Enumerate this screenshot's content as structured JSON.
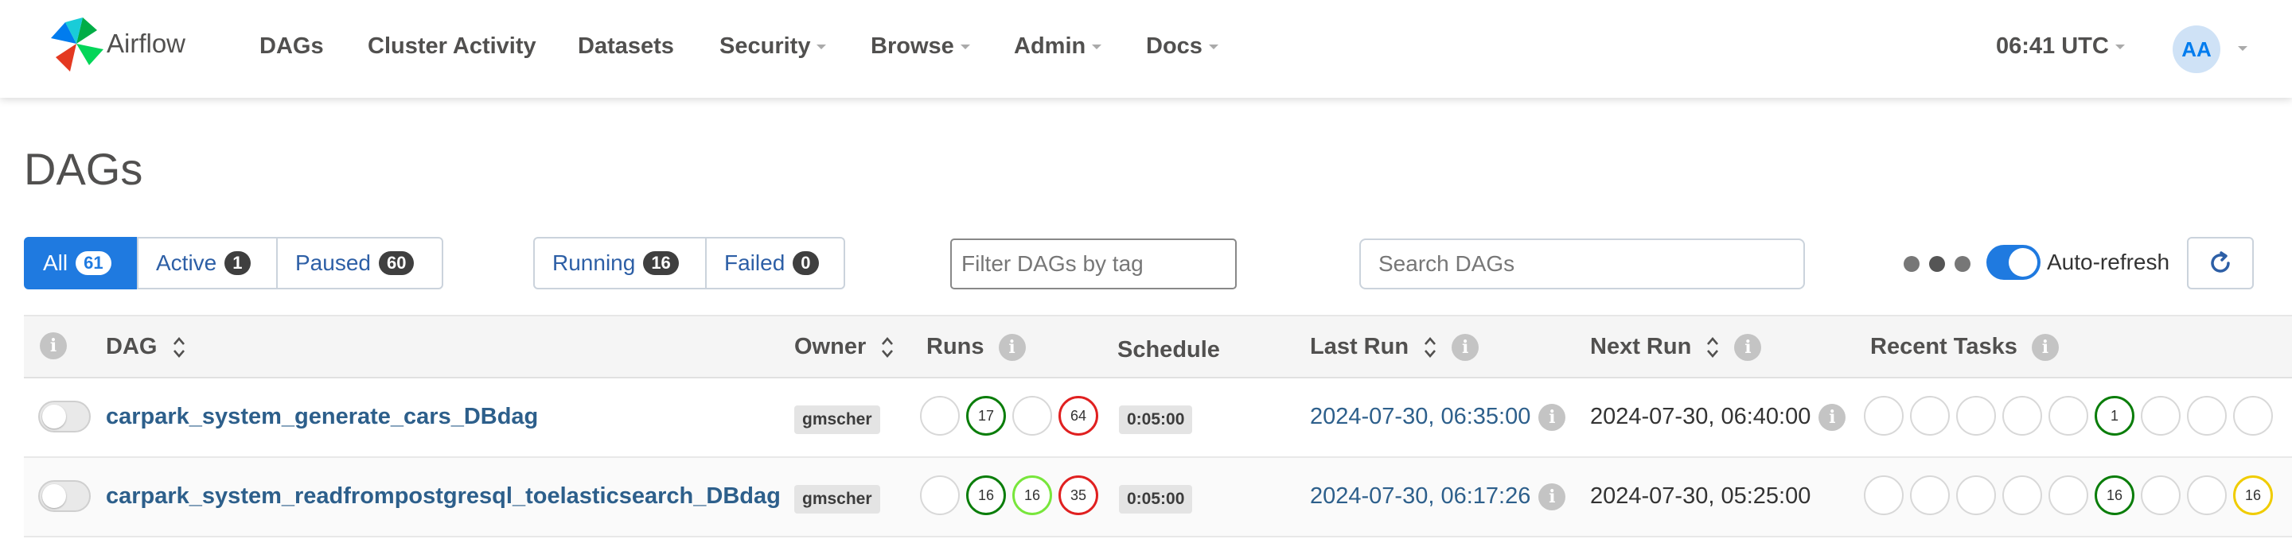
{
  "brand": {
    "name": "Airflow"
  },
  "nav": {
    "dags": "DAGs",
    "cluster_activity": "Cluster Activity",
    "datasets": "Datasets",
    "security": "Security",
    "browse": "Browse",
    "admin": "Admin",
    "docs": "Docs"
  },
  "clock": "06:41 UTC",
  "user": {
    "initials": "AA"
  },
  "page_title": "DAGs",
  "filters": {
    "all": {
      "label": "All",
      "count": "61"
    },
    "active": {
      "label": "Active",
      "count": "1"
    },
    "paused": {
      "label": "Paused",
      "count": "60"
    },
    "running": {
      "label": "Running",
      "count": "16"
    },
    "failed": {
      "label": "Failed",
      "count": "0"
    }
  },
  "tag_filter": {
    "placeholder": "Filter DAGs by tag"
  },
  "search": {
    "placeholder": "Search DAGs"
  },
  "auto_refresh": {
    "label": "Auto-refresh",
    "enabled": true
  },
  "table": {
    "headers": {
      "dag": "DAG",
      "owner": "Owner",
      "runs": "Runs",
      "schedule": "Schedule",
      "last_run": "Last Run",
      "next_run": "Next Run",
      "recent_tasks": "Recent Tasks"
    },
    "rows": [
      {
        "dag_id": "carpark_system_generate_cars_DBdag",
        "owner": "gmscher",
        "paused": true,
        "runs": [
          "",
          "17",
          "",
          "64"
        ],
        "schedule": "0:05:00",
        "last_run": "2024-07-30, 06:35:00",
        "next_run": "2024-07-30, 06:40:00",
        "recent_tasks": [
          "",
          "",
          "",
          "",
          "",
          "1",
          "",
          "",
          ""
        ]
      },
      {
        "dag_id": "carpark_system_readfrompostgresql_toelasticsearch_DBdag",
        "owner": "gmscher",
        "paused": true,
        "runs": [
          "",
          "16",
          "16",
          "35"
        ],
        "schedule": "0:05:00",
        "last_run": "2024-07-30, 06:17:26",
        "next_run": "2024-07-30, 05:25:00",
        "recent_tasks": [
          "",
          "",
          "",
          "",
          "",
          "16",
          "",
          "",
          "16"
        ]
      }
    ]
  },
  "colors": {
    "primary": "#1f7ae0",
    "link": "#2d5f8b",
    "success": "#0a7d0a",
    "running": "#78e63c",
    "failed": "#e02020",
    "queued": "#f0cc00"
  }
}
